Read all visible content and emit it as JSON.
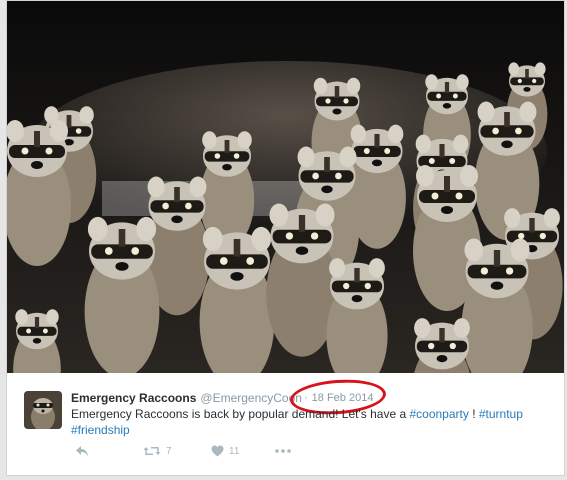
{
  "tweet": {
    "display_name": "Emergency Raccoons",
    "handle": "@EmergencyCoon",
    "timestamp_separator": "·",
    "timestamp": "18 Feb 2014",
    "text_main": "Emergency Raccoons is back by popular demand! Let's have a ",
    "hashtag_1": "#coonparty",
    "text_between": " ! ",
    "hashtag_2": "#turntup",
    "hashtag_3": "#friendship"
  },
  "actions": {
    "reply_icon": "reply-icon",
    "retweet_icon": "retweet-icon",
    "retweet_count": "7",
    "like_icon": "heart-icon",
    "like_count": "11",
    "more_icon": "more-dots-icon"
  },
  "colors": {
    "link": "#2b7bb9",
    "muted": "#8899a6",
    "highlight": "#d8121b"
  }
}
